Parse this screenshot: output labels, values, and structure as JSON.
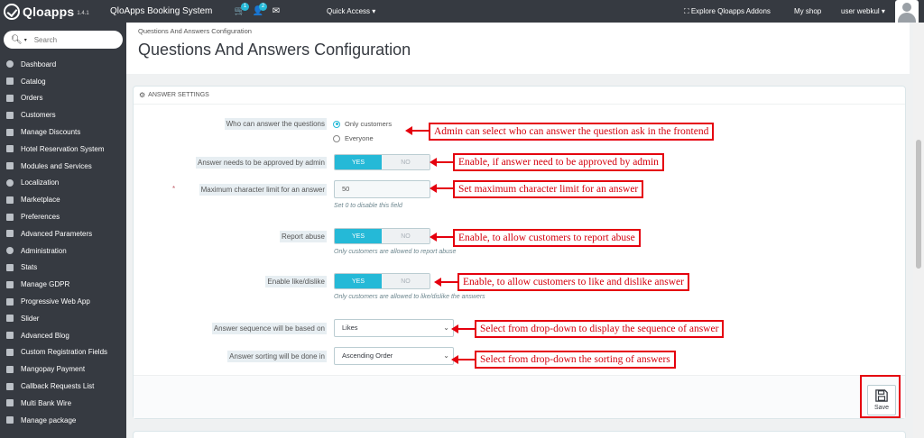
{
  "topbar": {
    "logo": "Qloapps",
    "version": "1.4.1",
    "brand": "QloApps Booking System",
    "cart_badge": "1",
    "customers_badge": "2",
    "quick_access": "Quick Access",
    "explore": "Explore Qloapps Addons",
    "my_shop": "My shop",
    "user": "user webkul"
  },
  "sidebar": {
    "search_placeholder": "Search",
    "items": [
      {
        "label": "Dashboard"
      },
      {
        "label": "Catalog"
      },
      {
        "label": "Orders"
      },
      {
        "label": "Customers"
      },
      {
        "label": "Manage Discounts"
      },
      {
        "label": "Hotel Reservation System"
      },
      {
        "label": "Modules and Services"
      },
      {
        "label": "Localization"
      },
      {
        "label": "Marketplace"
      },
      {
        "label": "Preferences"
      },
      {
        "label": "Advanced Parameters"
      },
      {
        "label": "Administration"
      },
      {
        "label": "Stats"
      },
      {
        "label": "Manage GDPR"
      },
      {
        "label": "Progressive Web App"
      },
      {
        "label": "Slider"
      },
      {
        "label": "Advanced Blog"
      },
      {
        "label": "Custom Registration Fields"
      },
      {
        "label": "Mangopay Payment"
      },
      {
        "label": "Callback Requests List"
      },
      {
        "label": "Multi Bank Wire"
      },
      {
        "label": "Manage package"
      }
    ]
  },
  "page": {
    "breadcrumb": "Questions And Answers Configuration",
    "title": "Questions And Answers Configuration"
  },
  "panel": {
    "heading": "ANSWER SETTINGS",
    "who_label": "Who can answer the questions",
    "who_options": [
      "Only customers",
      "Everyone"
    ],
    "who_selected": "Only customers",
    "approve_label": "Answer needs to be approved by admin",
    "approve_value": "YES",
    "max_char_label": "Maximum character limit for an answer",
    "max_char_required": "*",
    "max_char_value": "50",
    "max_char_help": "Set 0 to disable this field",
    "report_label": "Report abuse",
    "report_value": "YES",
    "report_help": "Only customers are allowed to report abuse",
    "like_label": "Enable like/dislike",
    "like_value": "YES",
    "like_help": "Only customers are allowed to like/dislike the answers",
    "sequence_label": "Answer sequence will be based on",
    "sequence_value": "Likes",
    "sorting_label": "Answer sorting will be done in",
    "sorting_value": "Ascending Order",
    "yes": "YES",
    "no": "NO",
    "save": "Save"
  },
  "annotations": {
    "who": "Admin can select who can answer the question ask in the frontend",
    "approve": "Enable, if answer need to be approved by admin",
    "max_char": "Set maximum character limit for an answer",
    "report": "Enable, to allow customers to report abuse",
    "like": "Enable, to allow customers to like and dislike answer",
    "sequence": "Select from drop-down to display the sequence of answer",
    "sorting": "Select from drop-down the sorting of answers"
  },
  "colors": {
    "topbar": "#363a41",
    "accent": "#25b9d7",
    "annotation": "#e5000e"
  }
}
